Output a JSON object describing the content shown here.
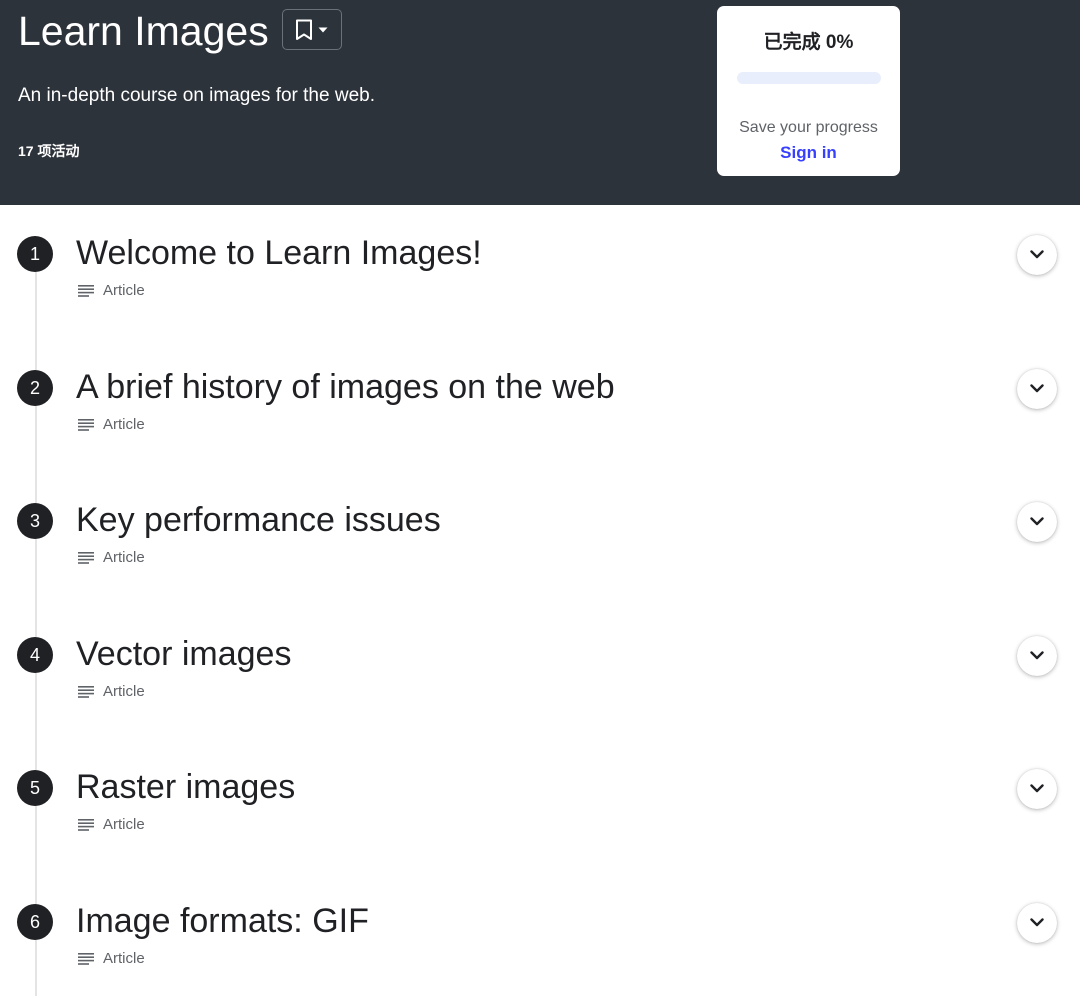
{
  "course": {
    "title": "Learn Images",
    "description": "An in-depth course on images for the web.",
    "activity_count": "17 项活动"
  },
  "bookmark": {
    "icon": "bookmark-icon",
    "dropdown_icon": "caret-down-icon"
  },
  "progress": {
    "label": "已完成 0%",
    "percent": 0,
    "save_text": "Save your progress",
    "signin_label": "Sign in",
    "accent_color": "#3740ff"
  },
  "colors": {
    "hero_background": "#2d333b",
    "text": "#202124",
    "muted_text": "#5f6368"
  },
  "units": [
    {
      "number": "1",
      "title": "Welcome to Learn Images!",
      "type": "Article",
      "type_icon": "article-icon"
    },
    {
      "number": "2",
      "title": "A brief history of images on the web",
      "type": "Article",
      "type_icon": "article-icon"
    },
    {
      "number": "3",
      "title": "Key performance issues",
      "type": "Article",
      "type_icon": "article-icon"
    },
    {
      "number": "4",
      "title": "Vector images",
      "type": "Article",
      "type_icon": "article-icon"
    },
    {
      "number": "5",
      "title": "Raster images",
      "type": "Article",
      "type_icon": "article-icon"
    },
    {
      "number": "6",
      "title": "Image formats: GIF",
      "type": "Article",
      "type_icon": "article-icon"
    }
  ]
}
